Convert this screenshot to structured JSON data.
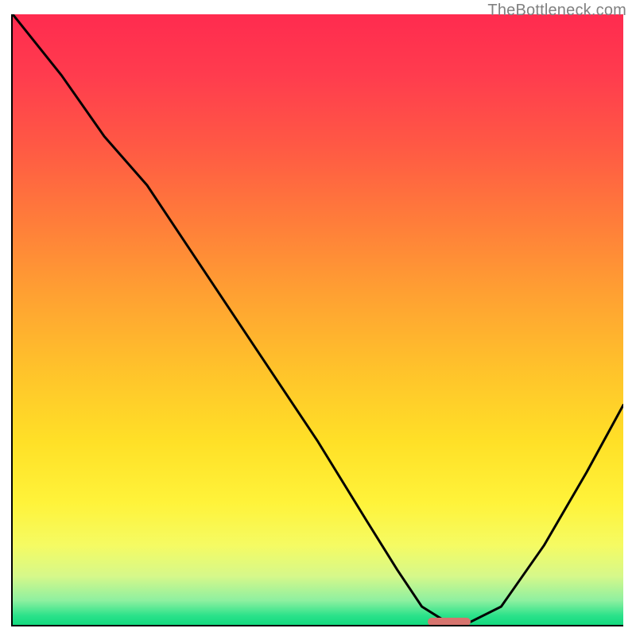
{
  "watermark": "TheBottleneck.com",
  "chart_data": {
    "type": "line",
    "title": "",
    "xlabel": "",
    "ylabel": "",
    "xlim": [
      0,
      100
    ],
    "ylim": [
      0,
      100
    ],
    "grid": false,
    "series": [
      {
        "name": "bottleneck-curve",
        "x": [
          0,
          8,
          15,
          22,
          30,
          40,
          50,
          58,
          63,
          67,
          71,
          75,
          80,
          87,
          94,
          100
        ],
        "y": [
          100,
          90,
          80,
          72,
          60,
          45,
          30,
          17,
          9,
          3,
          0.5,
          0.5,
          3,
          13,
          25,
          36
        ]
      }
    ],
    "marker": {
      "x_start": 68,
      "x_end": 75,
      "y": 0.5
    },
    "background_gradient": {
      "top_color": "#ff2b4f",
      "bottom_color": "#12d97e",
      "stops": [
        {
          "pct": 0,
          "color": "#ff2b4f"
        },
        {
          "pct": 50,
          "color": "#ffc22b"
        },
        {
          "pct": 85,
          "color": "#f5fb63"
        },
        {
          "pct": 100,
          "color": "#12d97e"
        }
      ]
    }
  }
}
